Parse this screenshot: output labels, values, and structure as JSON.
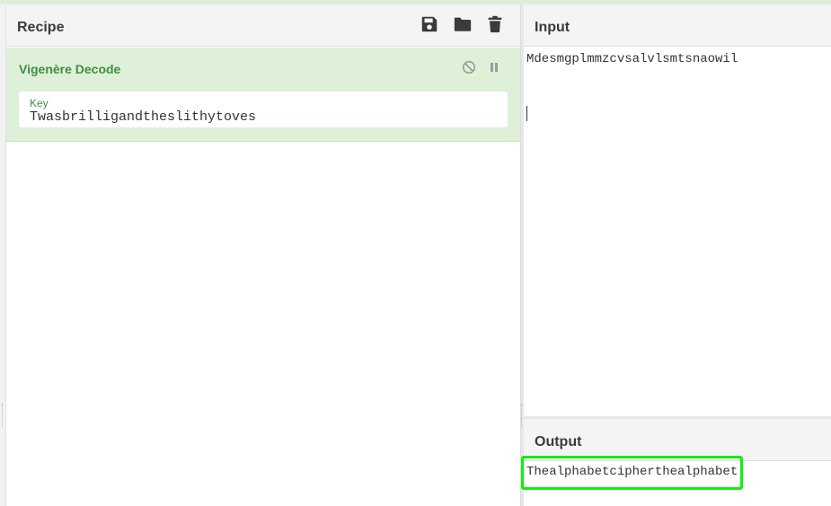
{
  "recipe": {
    "title": "Recipe",
    "icons": [
      "save-icon",
      "folder-icon",
      "trash-icon"
    ],
    "operation": {
      "name": "Vigenère Decode",
      "icons": [
        "disable-icon",
        "pause-icon"
      ],
      "key_label": "Key",
      "key_value": "Twasbrilligandtheslithytoves"
    }
  },
  "input": {
    "title": "Input",
    "text": "Mdesmgplmmzcvsalvlsmtsnaowil"
  },
  "output": {
    "title": "Output",
    "text": "Thealphabetcipherthealphabet"
  },
  "colors": {
    "operation_background": "#dff0d8",
    "operation_title": "#3e8e41",
    "highlight_border": "#11ee11"
  }
}
